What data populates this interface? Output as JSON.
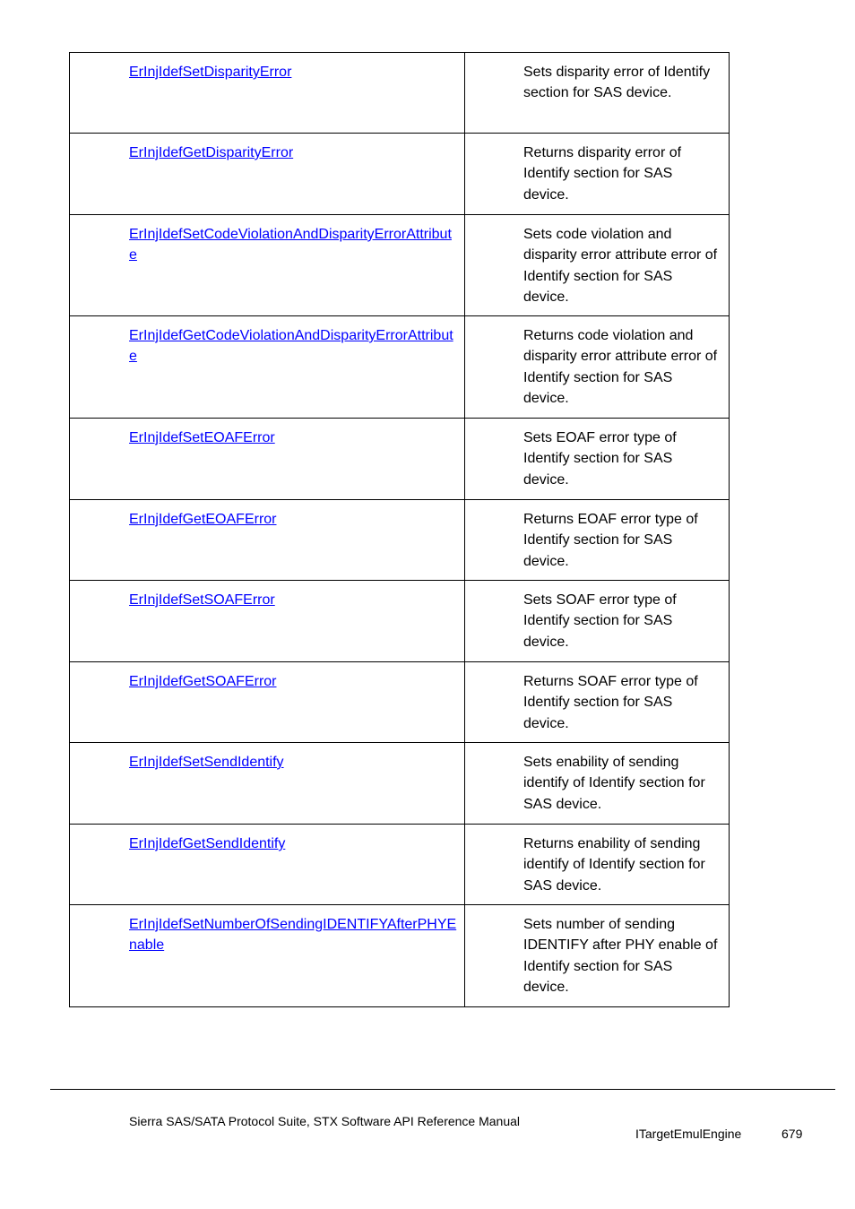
{
  "table": {
    "rows": [
      {
        "name": "ErInjIdefSetDisparityError",
        "desc": "Sets disparity error of Identify section for SAS device."
      },
      {
        "name": "ErInjIdefGetDisparityError",
        "desc": "Returns disparity error of Identify section for SAS device."
      },
      {
        "name": "ErInjIdefSetCodeViolationAndDisparityErrorAttribute",
        "desc": "Sets code violation and disparity error attribute error of Identify section for SAS device."
      },
      {
        "name": "ErInjIdefGetCodeViolationAndDisparityErrorAttribute",
        "desc": "Returns code violation and disparity error attribute error of Identify section for SAS device."
      },
      {
        "name": "ErInjIdefSetEOAFError",
        "desc": "Sets EOAF error type of Identify section for SAS device."
      },
      {
        "name": "ErInjIdefGetEOAFError",
        "desc": "Returns EOAF error type of Identify section for SAS device."
      },
      {
        "name": "ErInjIdefSetSOAFError",
        "desc": "Sets SOAF error type of Identify section for SAS device."
      },
      {
        "name": "ErInjIdefGetSOAFError",
        "desc": "Returns SOAF error type of Identify section for SAS device."
      },
      {
        "name": "ErInjIdefSetSendIdentify",
        "desc": "Sets enability of sending identify of Identify section for SAS device."
      },
      {
        "name": "ErInjIdefGetSendIdentify",
        "desc": "Returns enability of sending identify of Identify section for SAS device."
      },
      {
        "name": "ErInjIdefSetNumberOfSendingIDENTIFYAfterPHYEnable",
        "desc": "Sets number of sending IDENTIFY after PHY enable of Identify section for SAS device."
      }
    ]
  },
  "footer": {
    "manual_title": "Sierra SAS/SATA Protocol Suite, STX Software API Reference Manual",
    "section": "ITargetEmulEngine",
    "page_number": "679"
  },
  "colors": {
    "link": "#0000ff"
  }
}
